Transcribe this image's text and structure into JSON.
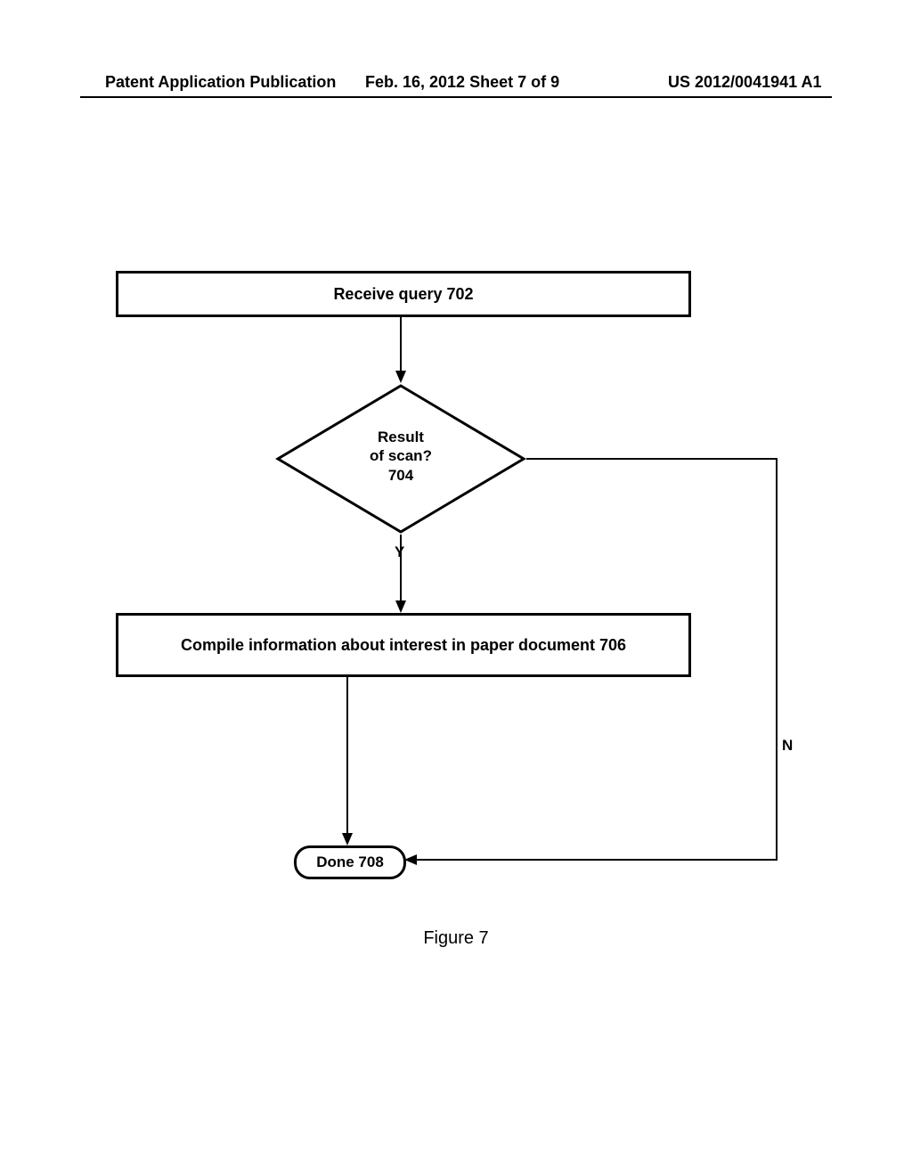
{
  "header": {
    "left": "Patent Application Publication",
    "center": "Feb. 16, 2012   Sheet 7 of 9",
    "right": "US 2012/0041941 A1"
  },
  "flow": {
    "step702": "Receive query 702",
    "dec704_line1": "Result",
    "dec704_line2": "of scan?",
    "dec704_line3": "704",
    "step706": "Compile information about interest in paper document  706",
    "done708": "Done 708",
    "label_y": "Y",
    "label_n": "N"
  },
  "caption": "Figure 7"
}
